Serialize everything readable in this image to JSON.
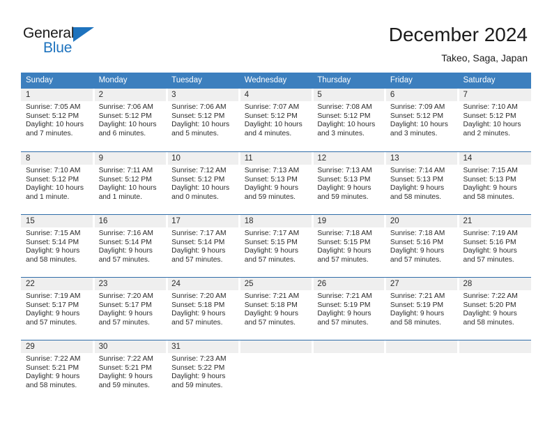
{
  "logo": {
    "top_text": "General",
    "bottom_text": "Blue",
    "triangle_icon": "triangle-icon",
    "brand_color": "#1e73be"
  },
  "header": {
    "title": "December 2024",
    "subtitle": "Takeo, Saga, Japan"
  },
  "colors": {
    "header_blue": "#3c7fbe",
    "row_divider": "#2f6ca8",
    "daynum_band": "#efefef",
    "text": "#2b2b2b"
  },
  "calendar": {
    "weekdays": [
      "Sunday",
      "Monday",
      "Tuesday",
      "Wednesday",
      "Thursday",
      "Friday",
      "Saturday"
    ],
    "weeks": [
      [
        {
          "day": "1",
          "sunrise": "Sunrise: 7:05 AM",
          "sunset": "Sunset: 5:12 PM",
          "daylight1": "Daylight: 10 hours",
          "daylight2": "and 7 minutes."
        },
        {
          "day": "2",
          "sunrise": "Sunrise: 7:06 AM",
          "sunset": "Sunset: 5:12 PM",
          "daylight1": "Daylight: 10 hours",
          "daylight2": "and 6 minutes."
        },
        {
          "day": "3",
          "sunrise": "Sunrise: 7:06 AM",
          "sunset": "Sunset: 5:12 PM",
          "daylight1": "Daylight: 10 hours",
          "daylight2": "and 5 minutes."
        },
        {
          "day": "4",
          "sunrise": "Sunrise: 7:07 AM",
          "sunset": "Sunset: 5:12 PM",
          "daylight1": "Daylight: 10 hours",
          "daylight2": "and 4 minutes."
        },
        {
          "day": "5",
          "sunrise": "Sunrise: 7:08 AM",
          "sunset": "Sunset: 5:12 PM",
          "daylight1": "Daylight: 10 hours",
          "daylight2": "and 3 minutes."
        },
        {
          "day": "6",
          "sunrise": "Sunrise: 7:09 AM",
          "sunset": "Sunset: 5:12 PM",
          "daylight1": "Daylight: 10 hours",
          "daylight2": "and 3 minutes."
        },
        {
          "day": "7",
          "sunrise": "Sunrise: 7:10 AM",
          "sunset": "Sunset: 5:12 PM",
          "daylight1": "Daylight: 10 hours",
          "daylight2": "and 2 minutes."
        }
      ],
      [
        {
          "day": "8",
          "sunrise": "Sunrise: 7:10 AM",
          "sunset": "Sunset: 5:12 PM",
          "daylight1": "Daylight: 10 hours",
          "daylight2": "and 1 minute."
        },
        {
          "day": "9",
          "sunrise": "Sunrise: 7:11 AM",
          "sunset": "Sunset: 5:12 PM",
          "daylight1": "Daylight: 10 hours",
          "daylight2": "and 1 minute."
        },
        {
          "day": "10",
          "sunrise": "Sunrise: 7:12 AM",
          "sunset": "Sunset: 5:12 PM",
          "daylight1": "Daylight: 10 hours",
          "daylight2": "and 0 minutes."
        },
        {
          "day": "11",
          "sunrise": "Sunrise: 7:13 AM",
          "sunset": "Sunset: 5:13 PM",
          "daylight1": "Daylight: 9 hours",
          "daylight2": "and 59 minutes."
        },
        {
          "day": "12",
          "sunrise": "Sunrise: 7:13 AM",
          "sunset": "Sunset: 5:13 PM",
          "daylight1": "Daylight: 9 hours",
          "daylight2": "and 59 minutes."
        },
        {
          "day": "13",
          "sunrise": "Sunrise: 7:14 AM",
          "sunset": "Sunset: 5:13 PM",
          "daylight1": "Daylight: 9 hours",
          "daylight2": "and 58 minutes."
        },
        {
          "day": "14",
          "sunrise": "Sunrise: 7:15 AM",
          "sunset": "Sunset: 5:13 PM",
          "daylight1": "Daylight: 9 hours",
          "daylight2": "and 58 minutes."
        }
      ],
      [
        {
          "day": "15",
          "sunrise": "Sunrise: 7:15 AM",
          "sunset": "Sunset: 5:14 PM",
          "daylight1": "Daylight: 9 hours",
          "daylight2": "and 58 minutes."
        },
        {
          "day": "16",
          "sunrise": "Sunrise: 7:16 AM",
          "sunset": "Sunset: 5:14 PM",
          "daylight1": "Daylight: 9 hours",
          "daylight2": "and 57 minutes."
        },
        {
          "day": "17",
          "sunrise": "Sunrise: 7:17 AM",
          "sunset": "Sunset: 5:14 PM",
          "daylight1": "Daylight: 9 hours",
          "daylight2": "and 57 minutes."
        },
        {
          "day": "18",
          "sunrise": "Sunrise: 7:17 AM",
          "sunset": "Sunset: 5:15 PM",
          "daylight1": "Daylight: 9 hours",
          "daylight2": "and 57 minutes."
        },
        {
          "day": "19",
          "sunrise": "Sunrise: 7:18 AM",
          "sunset": "Sunset: 5:15 PM",
          "daylight1": "Daylight: 9 hours",
          "daylight2": "and 57 minutes."
        },
        {
          "day": "20",
          "sunrise": "Sunrise: 7:18 AM",
          "sunset": "Sunset: 5:16 PM",
          "daylight1": "Daylight: 9 hours",
          "daylight2": "and 57 minutes."
        },
        {
          "day": "21",
          "sunrise": "Sunrise: 7:19 AM",
          "sunset": "Sunset: 5:16 PM",
          "daylight1": "Daylight: 9 hours",
          "daylight2": "and 57 minutes."
        }
      ],
      [
        {
          "day": "22",
          "sunrise": "Sunrise: 7:19 AM",
          "sunset": "Sunset: 5:17 PM",
          "daylight1": "Daylight: 9 hours",
          "daylight2": "and 57 minutes."
        },
        {
          "day": "23",
          "sunrise": "Sunrise: 7:20 AM",
          "sunset": "Sunset: 5:17 PM",
          "daylight1": "Daylight: 9 hours",
          "daylight2": "and 57 minutes."
        },
        {
          "day": "24",
          "sunrise": "Sunrise: 7:20 AM",
          "sunset": "Sunset: 5:18 PM",
          "daylight1": "Daylight: 9 hours",
          "daylight2": "and 57 minutes."
        },
        {
          "day": "25",
          "sunrise": "Sunrise: 7:21 AM",
          "sunset": "Sunset: 5:18 PM",
          "daylight1": "Daylight: 9 hours",
          "daylight2": "and 57 minutes."
        },
        {
          "day": "26",
          "sunrise": "Sunrise: 7:21 AM",
          "sunset": "Sunset: 5:19 PM",
          "daylight1": "Daylight: 9 hours",
          "daylight2": "and 57 minutes."
        },
        {
          "day": "27",
          "sunrise": "Sunrise: 7:21 AM",
          "sunset": "Sunset: 5:19 PM",
          "daylight1": "Daylight: 9 hours",
          "daylight2": "and 58 minutes."
        },
        {
          "day": "28",
          "sunrise": "Sunrise: 7:22 AM",
          "sunset": "Sunset: 5:20 PM",
          "daylight1": "Daylight: 9 hours",
          "daylight2": "and 58 minutes."
        }
      ],
      [
        {
          "day": "29",
          "sunrise": "Sunrise: 7:22 AM",
          "sunset": "Sunset: 5:21 PM",
          "daylight1": "Daylight: 9 hours",
          "daylight2": "and 58 minutes."
        },
        {
          "day": "30",
          "sunrise": "Sunrise: 7:22 AM",
          "sunset": "Sunset: 5:21 PM",
          "daylight1": "Daylight: 9 hours",
          "daylight2": "and 59 minutes."
        },
        {
          "day": "31",
          "sunrise": "Sunrise: 7:23 AM",
          "sunset": "Sunset: 5:22 PM",
          "daylight1": "Daylight: 9 hours",
          "daylight2": "and 59 minutes."
        },
        {
          "day": "",
          "sunrise": "",
          "sunset": "",
          "daylight1": "",
          "daylight2": ""
        },
        {
          "day": "",
          "sunrise": "",
          "sunset": "",
          "daylight1": "",
          "daylight2": ""
        },
        {
          "day": "",
          "sunrise": "",
          "sunset": "",
          "daylight1": "",
          "daylight2": ""
        },
        {
          "day": "",
          "sunrise": "",
          "sunset": "",
          "daylight1": "",
          "daylight2": ""
        }
      ]
    ]
  }
}
